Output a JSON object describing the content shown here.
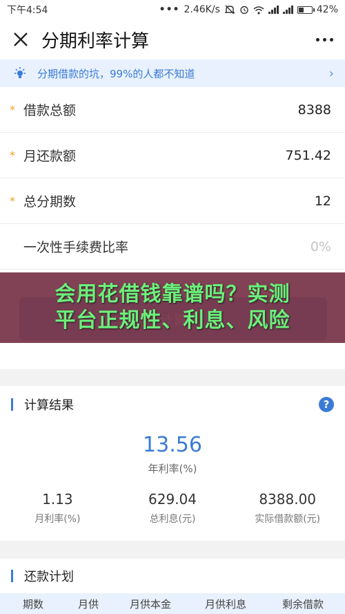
{
  "status_bar": {
    "time": "下午4:54",
    "dots": "•••",
    "speed": "2.46K/s",
    "battery": "42%",
    "battery_level": 0.42
  },
  "title_bar": {
    "title": "分期利率计算"
  },
  "notice": {
    "text": "分期借款的坑，99%的人都不知道"
  },
  "form": {
    "rows": [
      {
        "label": "借款总额",
        "value": "8388",
        "required": true
      },
      {
        "label": "月还款额",
        "value": "751.42",
        "required": true
      },
      {
        "label": "总分期数",
        "value": "12",
        "required": true
      },
      {
        "label": "一次性手续费比率",
        "value": "0%",
        "required": false
      }
    ],
    "required_mark": "*"
  },
  "calculate_button": {
    "label": "计算"
  },
  "banner": {
    "line1": "会用花借钱靠谱吗？实测",
    "line2": "平台正规性、利息、风险"
  },
  "result": {
    "title": "计算结果",
    "help": "?",
    "annual_rate": {
      "value": "13.56",
      "label": "年利率(%)"
    },
    "stats": [
      {
        "value": "1.13",
        "label": "月利率(%)"
      },
      {
        "value": "629.04",
        "label": "总利息(元)"
      },
      {
        "value": "8388.00",
        "label": "实际借款额(元)"
      }
    ]
  },
  "plan": {
    "title": "还款计划",
    "columns": [
      "期数",
      "月供",
      "月供本金",
      "月供利息",
      "剩余借款"
    ]
  },
  "colors": {
    "accent": "#3a7bd5",
    "required_star": "#f0a020",
    "notice_bg": "#e8f1fd",
    "banner_text": "#6cf07a"
  },
  "icons": {
    "close": "close-icon",
    "more": "more-icon",
    "bulb": "lightbulb-icon",
    "chevron": "chevron-right-icon",
    "help": "help-icon"
  }
}
